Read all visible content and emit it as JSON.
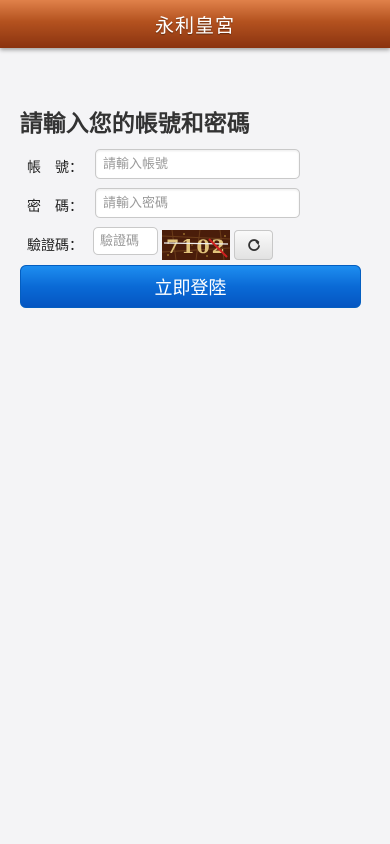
{
  "header": {
    "title": "永利皇宮"
  },
  "form": {
    "heading": "請輸入您的帳號和密碼",
    "account_label": "帳　號：",
    "account_placeholder": "請輸入帳號",
    "password_label": "密　碼：",
    "password_placeholder": "請輸入密碼",
    "captcha_label": "驗證碼：",
    "captcha_placeholder": "驗證碼",
    "captcha_text": "7102",
    "refresh_icon": "refresh-icon",
    "submit_label": "立即登陸"
  },
  "colors": {
    "header_start": "#e0814a",
    "header_end": "#8a3310",
    "button_blue": "#0a6ad6",
    "captcha_bg": "#4a1d0a"
  }
}
